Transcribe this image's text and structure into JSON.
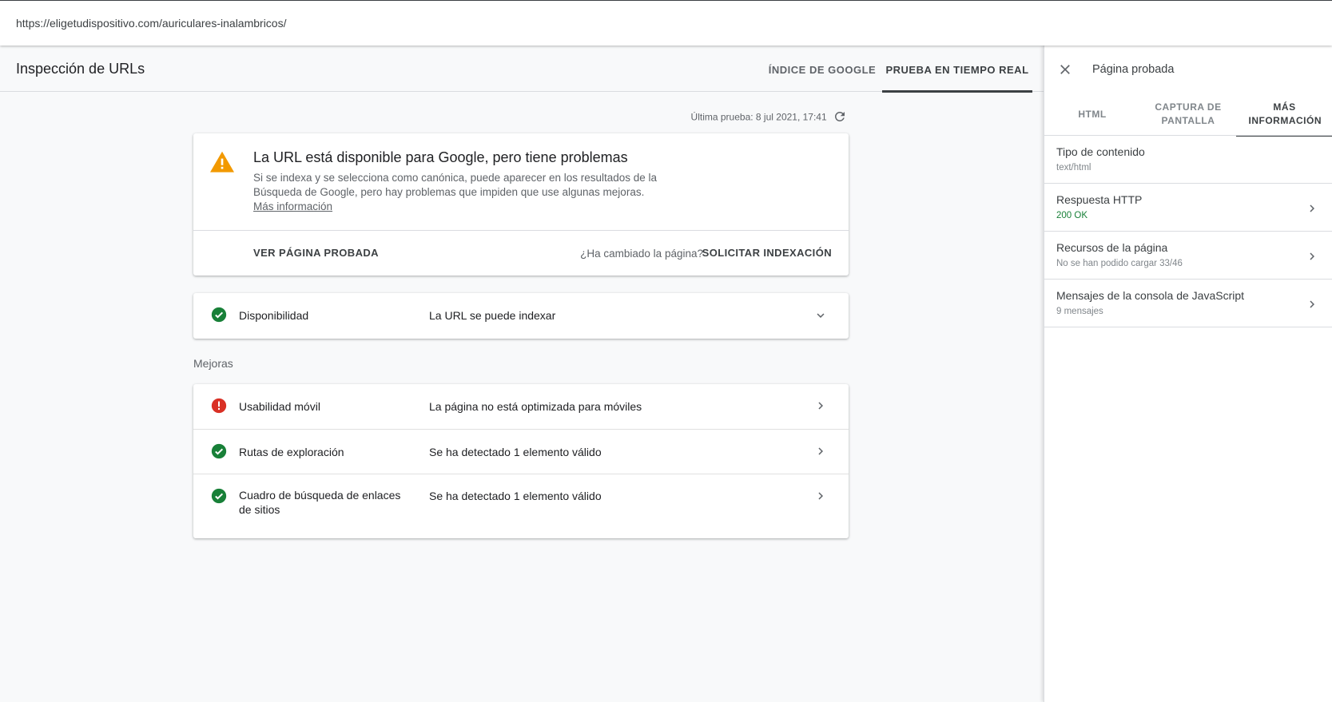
{
  "url": "https://eligetudispositivo.com/auriculares-inalambricos/",
  "header": {
    "title": "Inspección de URLs",
    "tabs": [
      {
        "label": "ÍNDICE DE GOOGLE"
      },
      {
        "label": "PRUEBA EN TIEMPO REAL",
        "active": true
      }
    ]
  },
  "last_test": "Última prueba: 8 jul 2021, 17:41",
  "status_card": {
    "icon": "warning-icon",
    "headline": "La URL está disponible para Google, pero tiene problemas",
    "description": "Si se indexa y se selecciona como canónica, puede aparecer en los resultados de la Búsqueda de Google, pero hay problemas que impiden que use algunas mejoras.",
    "more_info": "Más información",
    "view_button": "VER PÁGINA PROBADA",
    "changed_prompt": "¿Ha cambiado la página?",
    "request_button": "SOLICITAR INDEXACIÓN"
  },
  "availability": {
    "label": "Disponibilidad",
    "value": "La URL se puede indexar",
    "status": "ok"
  },
  "improvements": {
    "label": "Mejoras",
    "rows": [
      {
        "label": "Usabilidad móvil",
        "value": "La página no está optimizada para móviles",
        "status": "error"
      },
      {
        "label": "Rutas de exploración",
        "value": "Se ha detectado 1 elemento válido",
        "status": "ok"
      },
      {
        "label": "Cuadro de búsqueda de enlaces de sitios",
        "value": "Se ha detectado 1 elemento válido",
        "status": "ok"
      }
    ]
  },
  "panel": {
    "title": "Página probada",
    "tabs": [
      {
        "label": "HTML"
      },
      {
        "label": "CAPTURA DE PANTALLA"
      },
      {
        "label": "MÁS INFORMACIÓN",
        "active": true
      }
    ],
    "rows": [
      {
        "label": "Tipo de contenido",
        "value": "text/html"
      },
      {
        "label": "Respuesta HTTP",
        "value": "200 OK"
      },
      {
        "label": "Recursos de la página",
        "value": "No se han podido cargar 33/46"
      },
      {
        "label": "Mensajes de la consola de JavaScript",
        "value": "9 mensajes"
      }
    ]
  },
  "colors": {
    "ok": "#188038",
    "error": "#d93025",
    "warning": "#f29900",
    "accent": "#3c4043"
  }
}
